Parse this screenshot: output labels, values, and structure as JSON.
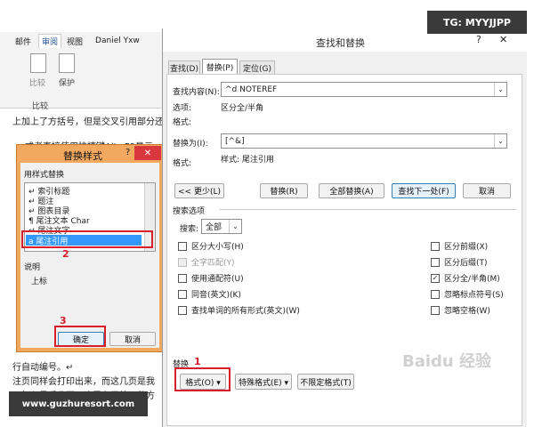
{
  "watermark_top": "TG: MYYJJPP",
  "watermark_bottom": "www.guzhuresort.com",
  "baidu_watermark": "Baidu 经验",
  "ribbon": {
    "tabs": [
      "邮件",
      "审阅",
      "视图"
    ],
    "user": "Daniel Yxw",
    "compare": "比较",
    "protect": "保护",
    "group_compare": "比较"
  },
  "doc": {
    "line1": "上加上了方括号，但是交叉引用部分还",
    "line2": "式者直接使用快捷键Alt+F9显示",
    "line3": "行自动编号。↵",
    "line4": "注页同样会打印出来，而这几页是我",
    "line5": "不打印最后几页，这里有另外一种方"
  },
  "style_dialog": {
    "title": "替换样式",
    "help": "?",
    "close": "✕",
    "list_label": "用样式替换",
    "items": [
      "索引标题",
      "题注",
      "图表目录",
      "尾注文本 Char",
      "尾注文字",
      "尾注引用"
    ],
    "selected": "尾注引用",
    "desc_label": "说明",
    "desc": "上标",
    "ok": "确定",
    "cancel": "取消"
  },
  "find_dialog": {
    "title": "查找和替换",
    "help": "?",
    "close": "✕",
    "tabs": [
      "查找(D)",
      "替换(P)",
      "定位(G)"
    ],
    "find_label": "查找内容(N):",
    "find_value": "^d NOTEREF",
    "options_label": "选项:",
    "options_value": "区分全/半角",
    "format_label": "格式:",
    "replace_label": "替换为(I):",
    "replace_value": "[^&]",
    "format_label2": "格式:",
    "format_value2": "样式: 尾注引用",
    "buttons": {
      "less": "<< 更少(L)",
      "replace": "替换(R)",
      "replace_all": "全部替换(A)",
      "find_next": "查找下一处(F)",
      "cancel": "取消"
    },
    "search_options": "搜索选项",
    "search_label": "搜索:",
    "search_value": "全部",
    "checks_left": [
      {
        "label": "区分大小写(H)",
        "checked": false,
        "disabled": false
      },
      {
        "label": "全字匹配(Y)",
        "checked": false,
        "disabled": true
      },
      {
        "label": "使用通配符(U)",
        "checked": false,
        "disabled": false
      },
      {
        "label": "同音(英文)(K)",
        "checked": false,
        "disabled": false
      },
      {
        "label": "查找单词的所有形式(英文)(W)",
        "checked": false,
        "disabled": false
      }
    ],
    "checks_right": [
      {
        "label": "区分前缀(X)",
        "checked": false
      },
      {
        "label": "区分后缀(T)",
        "checked": false
      },
      {
        "label": "区分全/半角(M)",
        "checked": true
      },
      {
        "label": "忽略标点符号(S)",
        "checked": false
      },
      {
        "label": "忽略空格(W)",
        "checked": false
      }
    ],
    "replace_section": "替换",
    "format_btn": "格式(O) ▾",
    "special_btn": "特殊格式(E) ▾",
    "noformat_btn": "不限定格式(T)"
  },
  "annotations": {
    "n1": "1",
    "n2": "2",
    "n3": "3"
  },
  "colors": {
    "red": "#d61f2a",
    "dialog_orange": "#f3a860",
    "selection": "#3399ff"
  }
}
